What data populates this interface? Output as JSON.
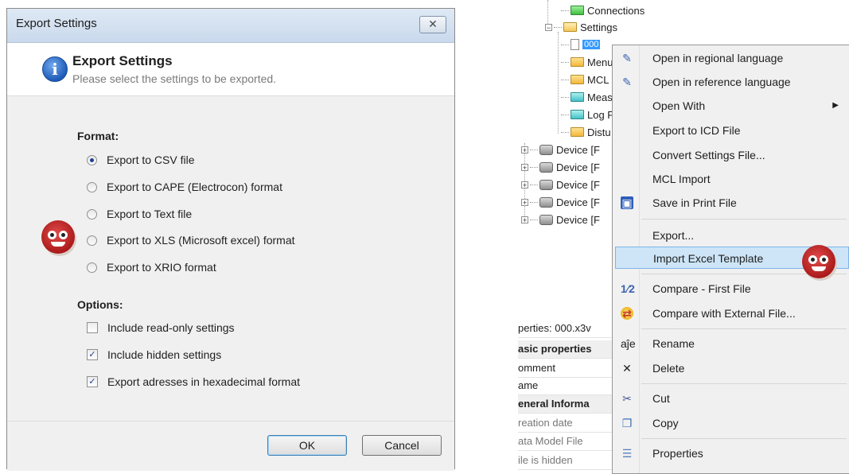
{
  "dialog": {
    "title": "Export Settings",
    "close_glyph": "✕",
    "header_title": "Export Settings",
    "header_subtitle": "Please select the settings to be exported.",
    "format_heading": "Format:",
    "formats": [
      {
        "label": "Export to CSV file",
        "selected": true
      },
      {
        "label": "Export to CAPE (Electrocon) format",
        "selected": false
      },
      {
        "label": "Export to Text file",
        "selected": false
      },
      {
        "label": "Export to XLS (Microsoft excel) format",
        "selected": false
      },
      {
        "label": "Export to XRIO format",
        "selected": false
      }
    ],
    "options_heading": "Options:",
    "options": [
      {
        "label": "Include read-only settings",
        "checked": false
      },
      {
        "label": "Include hidden settings",
        "checked": true
      },
      {
        "label": "Export adresses in hexadecimal format",
        "checked": true
      }
    ],
    "ok_label": "OK",
    "cancel_label": "Cancel"
  },
  "tree": {
    "nodes": [
      "Connections",
      "Settings",
      "000",
      "Menu",
      "MCL",
      "Meas",
      "Log F",
      "Distu"
    ],
    "devices": [
      "Device [F",
      "Device [F",
      "Device [F",
      "Device [F",
      "Device [F"
    ]
  },
  "properties": {
    "title": "perties: 000.x3v",
    "rows": [
      {
        "text": "asic properties",
        "style": "bold"
      },
      {
        "text": "omment",
        "style": "normal"
      },
      {
        "text": "ame",
        "style": "normal"
      },
      {
        "text": "eneral Informa",
        "style": "bold"
      },
      {
        "text": "reation date",
        "style": "grey"
      },
      {
        "text": "ata Model File",
        "style": "grey"
      },
      {
        "text": "ile is hidden",
        "style": "grey"
      }
    ]
  },
  "context_menu": {
    "items": [
      {
        "label": "Open in regional language",
        "icon": "edit-icon"
      },
      {
        "label": "Open in reference language",
        "icon": "edit-icon"
      },
      {
        "label": "Open With",
        "icon": "",
        "submenu": true
      },
      {
        "label": "Export to ICD File",
        "icon": ""
      },
      {
        "label": "Convert Settings File...",
        "icon": ""
      },
      {
        "label": "MCL Import",
        "icon": ""
      },
      {
        "label": "Save in Print File",
        "icon": "save-icon"
      },
      {
        "label": "Export...",
        "icon": ""
      },
      {
        "label": "Import Excel Template",
        "icon": "",
        "highlighted": true
      },
      {
        "label": "Compare - First File",
        "icon": "compare-icon"
      },
      {
        "label": "Compare with External File...",
        "icon": "compare-external-icon"
      },
      {
        "label": "Rename",
        "icon": "rename-icon"
      },
      {
        "label": "Delete",
        "icon": "delete-icon"
      },
      {
        "label": "Cut",
        "icon": "cut-icon"
      },
      {
        "label": "Copy",
        "icon": "copy-icon"
      },
      {
        "label": "Properties",
        "icon": "properties-icon"
      }
    ],
    "submenu_arrow": "▶"
  },
  "colors": {
    "menu_highlight": "#cde5f7",
    "selection": "#3399ff",
    "mascot": "#c92222"
  }
}
